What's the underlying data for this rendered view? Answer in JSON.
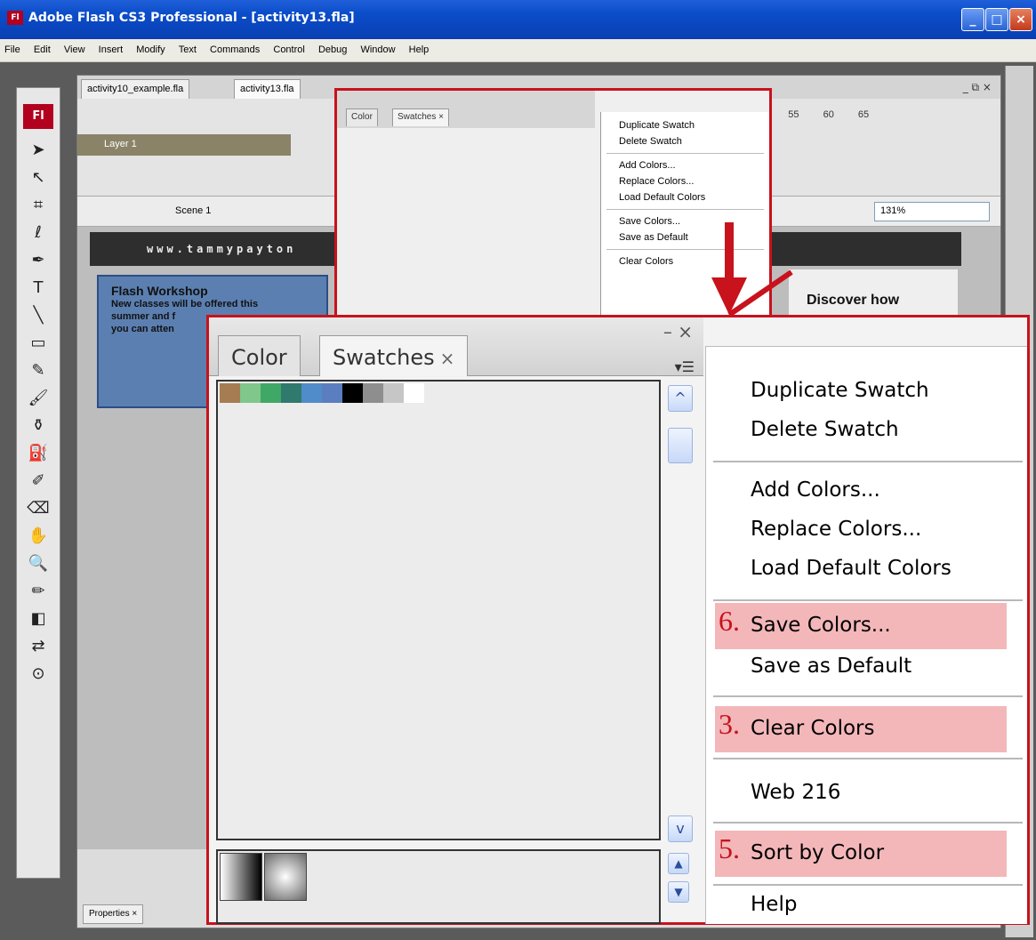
{
  "window": {
    "title": "Adobe Flash CS3 Professional - [activity13.fla]",
    "app_icon": "Fl"
  },
  "menubar": [
    "File",
    "Edit",
    "View",
    "Insert",
    "Modify",
    "Text",
    "Commands",
    "Control",
    "Debug",
    "Window",
    "Help"
  ],
  "tools": {
    "logo": "Fl"
  },
  "document": {
    "tabs": [
      "activity10_example.fla",
      "activity13.fla"
    ],
    "layer": "Layer 1",
    "frame_numbers": "50 55 60 65",
    "scene": "Scene 1",
    "zoom": "131%",
    "site_header": "www.tammypayton",
    "workshop": {
      "heading": "Flash Workshop",
      "body_1": "New classes will be offered this",
      "body_2": "summer and f",
      "body_3": "you can atten"
    },
    "discover": "Discover how",
    "properties_tab": "Properties ×"
  },
  "small_panel": {
    "tabs": [
      "Color",
      "Swatches ×"
    ],
    "menu": [
      "Duplicate Swatch",
      "Delete Swatch",
      "Add Colors...",
      "Replace Colors...",
      "Load Default Colors",
      "Save Colors...",
      "Save as Default",
      "Clear Colors"
    ]
  },
  "panel": {
    "controls": "– ×",
    "options_icon": "▾☰",
    "tabs": {
      "color": "Color",
      "swatches": "Swatches",
      "swatches_close": "×"
    },
    "swatch_colors": [
      "#a67c52",
      "#7fc78a",
      "#3fa866",
      "#2f7a6d",
      "#4f8cc9",
      "#5a7ebf",
      "#000000",
      "#8e8e8e",
      "#c6c6c6",
      "#ffffff"
    ],
    "menu": {
      "duplicate": "Duplicate Swatch",
      "delete": "Delete Swatch",
      "add": "Add Colors...",
      "replace": "Replace Colors...",
      "load_default": "Load Default Colors",
      "save": "Save Colors...",
      "save_default": "Save as Default",
      "clear": "Clear Colors",
      "web216": "Web 216",
      "sort": "Sort by Color",
      "help": "Help"
    },
    "steps": {
      "save": "6.",
      "clear": "3.",
      "sort": "5."
    }
  },
  "colors": {
    "highlight": "#f3b7ba",
    "callout_border": "#c8121c",
    "title_bar": "#0b4dc9"
  }
}
